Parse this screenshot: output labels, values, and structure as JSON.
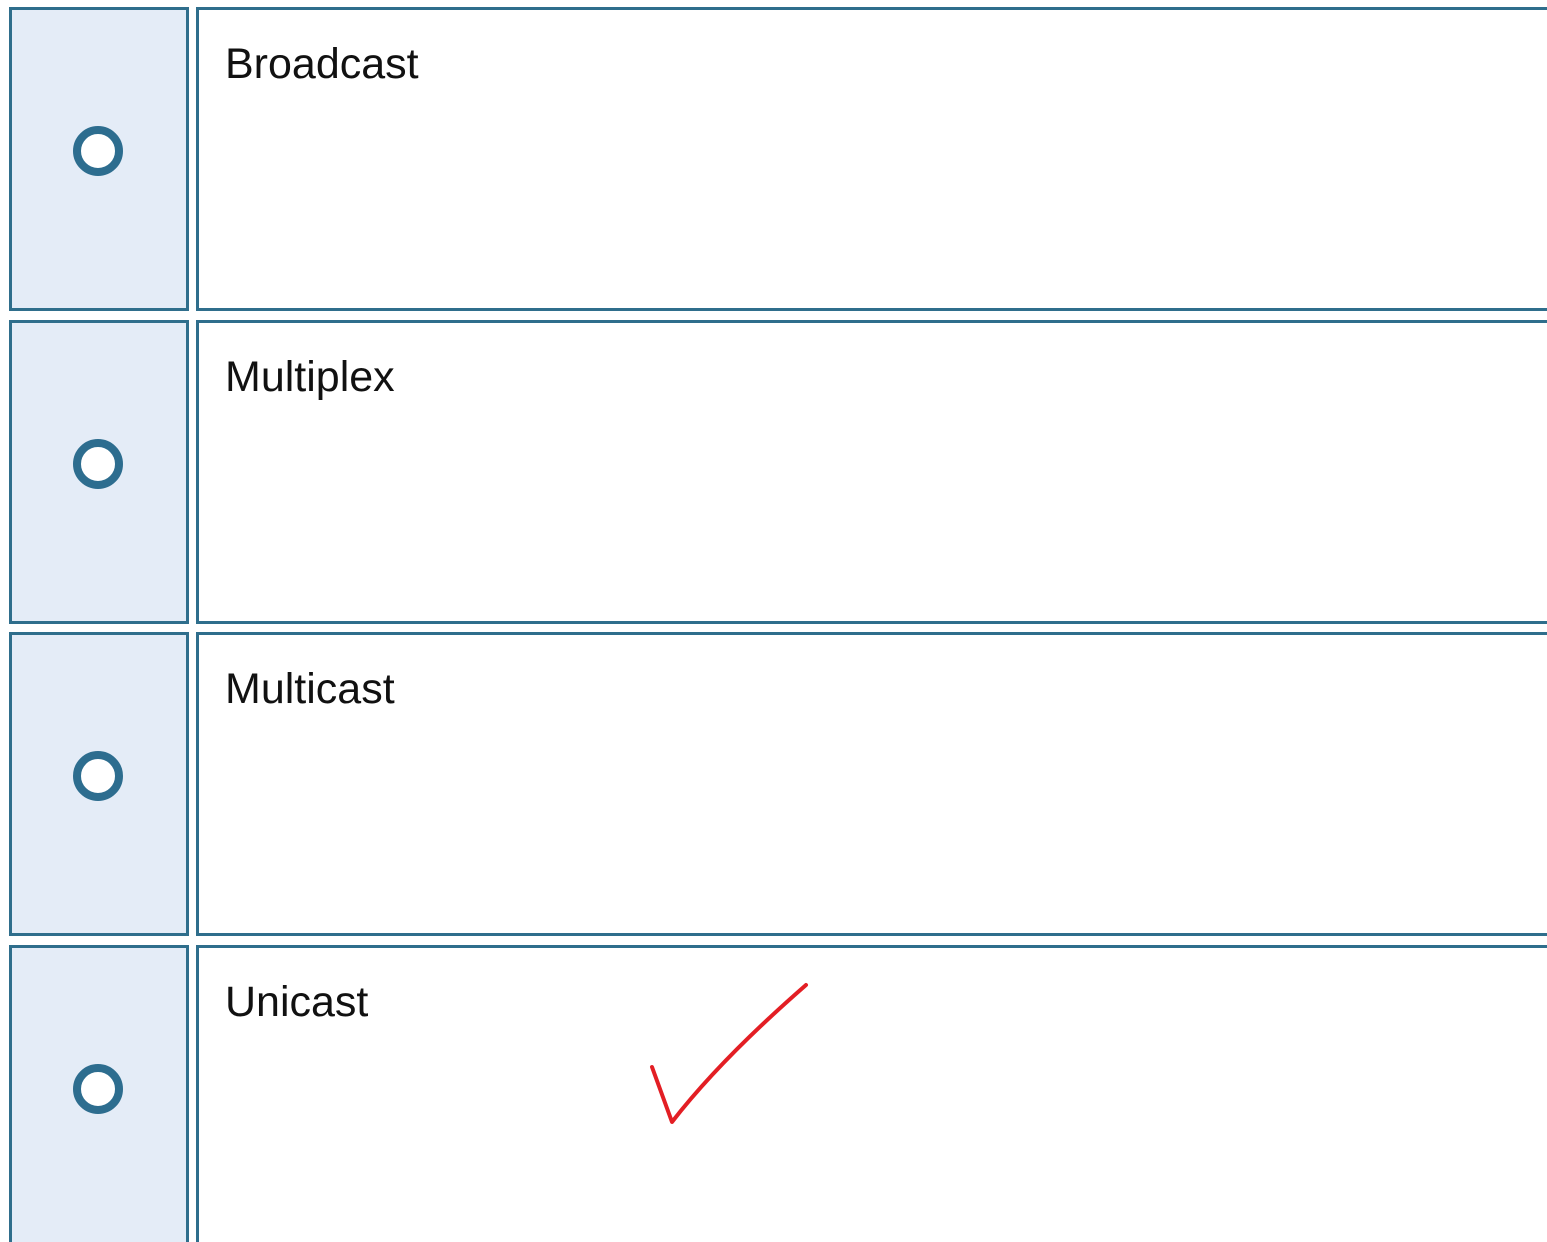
{
  "options": [
    {
      "label": "Broadcast"
    },
    {
      "label": "Multiplex"
    },
    {
      "label": "Multicast"
    },
    {
      "label": "Unicast"
    }
  ],
  "colors": {
    "border": "#2f6e8c",
    "radio_cell_bg": "#e4ecf7",
    "checkmark": "#e31e24"
  },
  "annotation": {
    "icon": "checkmark-icon",
    "marked_option": "Unicast"
  }
}
